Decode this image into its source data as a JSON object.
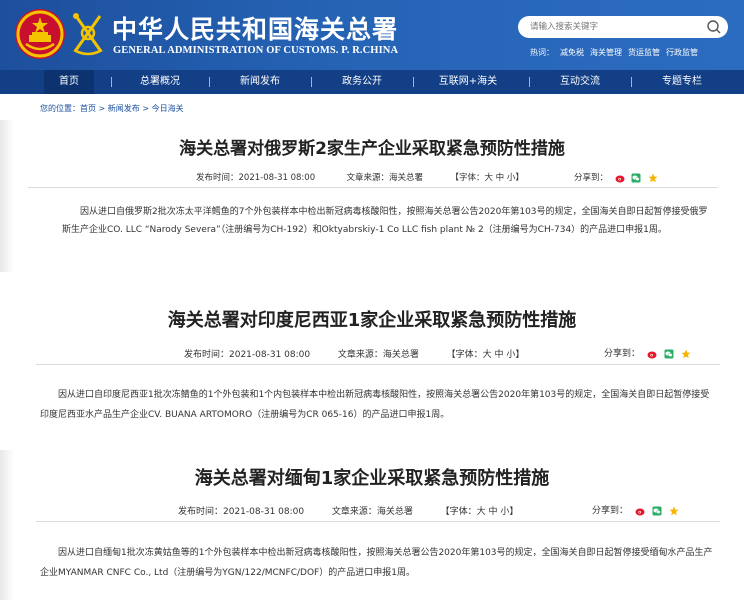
{
  "header": {
    "site_title_cn": "中华人民共和国海关总署",
    "site_title_en": "GENERAL ADMINISTRATION OF CUSTOMS. P. R.CHINA",
    "search_placeholder": "请输入搜索关键字",
    "hot_label": "热词：",
    "hot_words": [
      "减免税",
      "海关管理",
      "货运监管",
      "行政监管"
    ]
  },
  "nav": {
    "items": [
      {
        "label": "首页",
        "active": true
      },
      {
        "label": "总署概况"
      },
      {
        "label": "新闻发布"
      },
      {
        "label": "政务公开"
      },
      {
        "label": "互联网+海关"
      },
      {
        "label": "互动交流"
      },
      {
        "label": "专题专栏"
      }
    ]
  },
  "breadcrumb": "您的位置：首页 > 新闻发布 > 今日海关",
  "articles": [
    {
      "title": "海关总署对俄罗斯2家生产企业采取紧急预防性措施",
      "publish_time": "发布时间：2021-08-31 08:00",
      "source": "文章来源：海关总署",
      "font_size": "【字体：大 中 小】",
      "share_label": "分享到：",
      "body": "因从进口自俄罗斯2批次冻太平洋鳕鱼的7个外包装样本中检出新冠病毒核酸阳性，按照海关总署公告2020年第103号的规定，全国海关自即日起暂停接受俄罗斯生产企业CO. LLC “Narody Severa”（注册编号为CH-192）和Oktyabrskiy-1 Co LLC fish plant № 2（注册编号为CH-734）的产品进口申报1周。"
    },
    {
      "title": "海关总署对印度尼西亚1家企业采取紧急预防性措施",
      "publish_time": "发布时间：2021-08-31 08:00",
      "source": "文章来源：海关总署",
      "font_size": "【字体：大 中 小】",
      "share_label": "分享到：",
      "body": "因从进口自印度尼西亚1批次冻鲭鱼的1个外包装和1个内包装样本中检出新冠病毒核酸阳性，按照海关总署公告2020年第103号的规定，全国海关自即日起暂停接受印度尼西亚水产品生产企业CV. BUANA ARTOMORO（注册编号为CR 065-16）的产品进口申报1周。"
    },
    {
      "title": "海关总署对缅甸1家企业采取紧急预防性措施",
      "publish_time": "发布时间：2021-08-31 08:00",
      "source": "文章来源：海关总署",
      "font_size": "【字体：大 中 小】",
      "share_label": "分享到：",
      "body": "因从进口自缅甸1批次冻黄姑鱼等的1个外包装样本中检出新冠病毒核酸阳性，按照海关总署公告2020年第103号的规定，全国海关自即日起暂停接受缅甸水产品生产企业MYANMAR CNFC Co., Ltd（注册编号为YGN/122/MCNFC/DOF）的产品进口申报1周。"
    }
  ],
  "colors": {
    "header_blue": "#2563b5",
    "nav_blue": "#123f86",
    "weibo_red": "#e6162d",
    "wechat_green": "#2aae67",
    "star_yellow": "#f5b400"
  }
}
